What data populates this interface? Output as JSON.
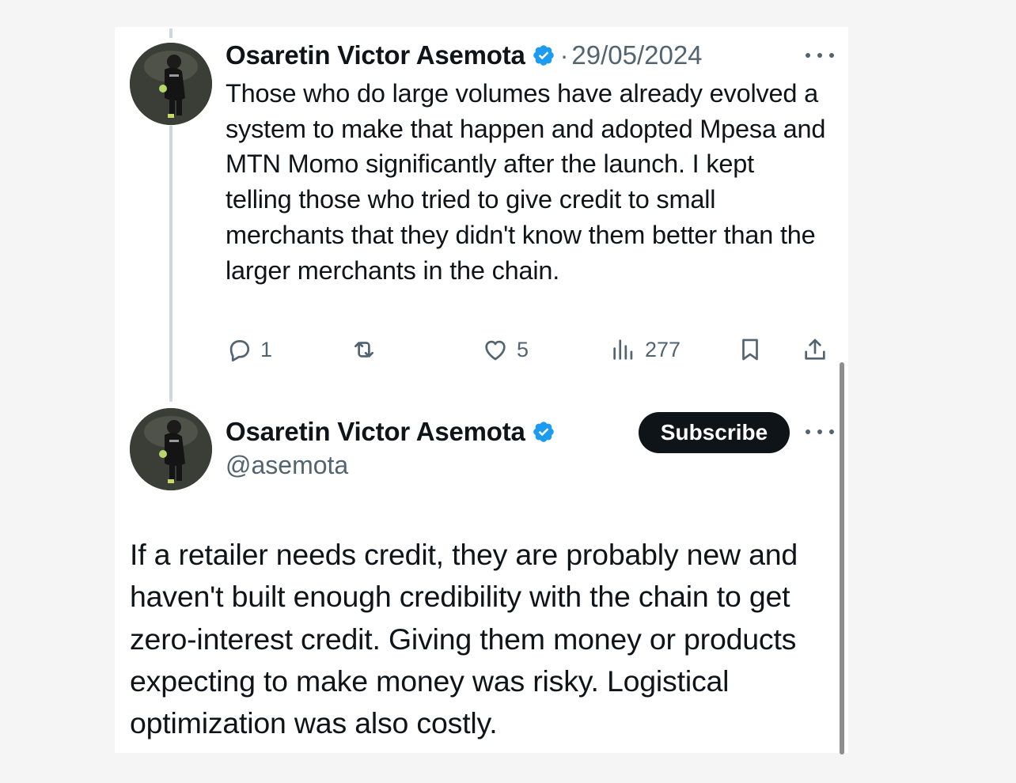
{
  "colors": {
    "text_primary": "#0f1419",
    "text_secondary": "#536471",
    "verified_blue": "#1d9bf0",
    "thread_line": "#cfd9de",
    "subscribe_bg": "#0f1419"
  },
  "parent_tweet": {
    "author_name": "Osaretin Victor Asemota",
    "verified_icon": "verified-badge-icon",
    "separator": "·",
    "date": "29/05/2024",
    "text": "Those who do large volumes have already evolved a system to make that happen and adopted Mpesa and MTN Momo significantly after the launch. I kept telling those who tried to give credit to small merchants that they didn't know them better than the larger merchants in the chain.",
    "actions": {
      "reply_count": "1",
      "retweet_count": "",
      "like_count": "5",
      "views_count": "277"
    }
  },
  "main_tweet": {
    "author_name": "Osaretin Victor Asemota",
    "verified_icon": "verified-badge-icon",
    "handle": "@asemota",
    "subscribe_label": "Subscribe",
    "text": "If a retailer needs credit, they are probably new and haven't built enough credibility with the chain to get zero-interest credit. Giving them money or products expecting to make money was risky. Logistical optimization was also costly."
  }
}
